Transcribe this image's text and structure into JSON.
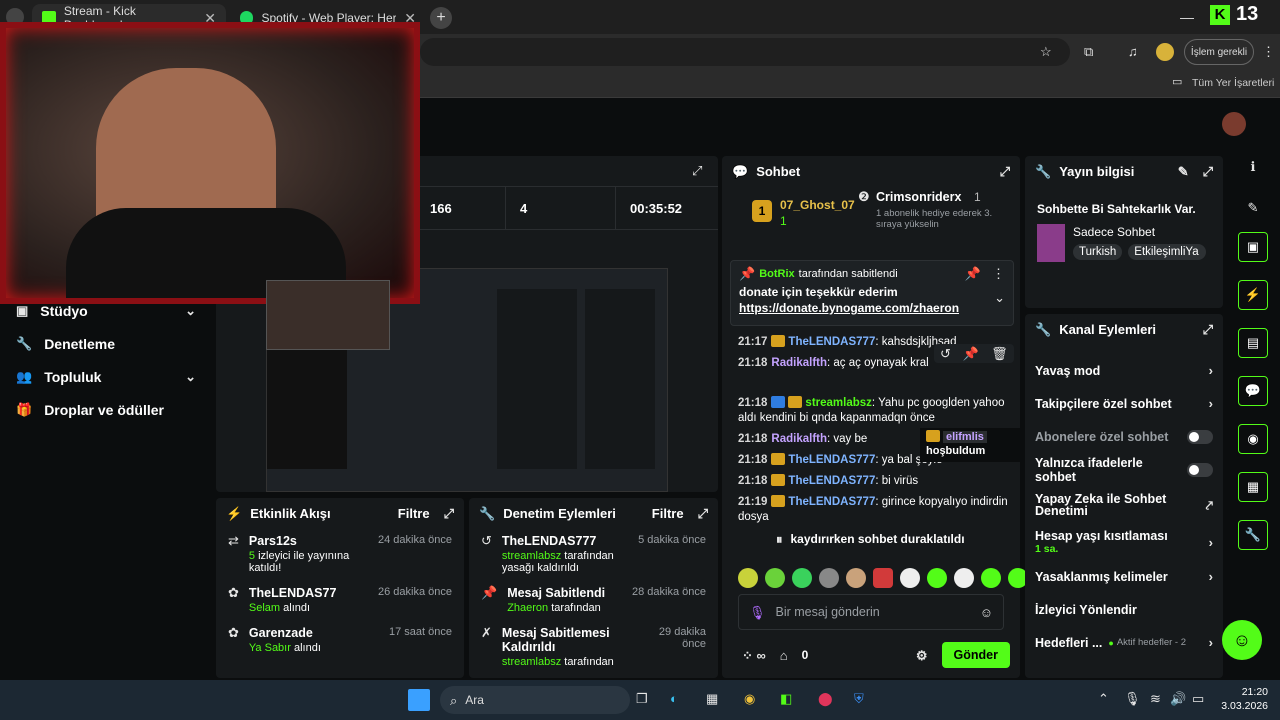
{
  "browser": {
    "tabs": [
      {
        "title": "Stream - Kick Dashboard"
      },
      {
        "title": "Spotify - Web Player: Herşe s"
      }
    ],
    "profile_label": "İşlem gerekli",
    "bookmarks_label": "Tüm Yer İşaretleri",
    "kick_count": "13"
  },
  "sidebar": {
    "items": [
      {
        "label": "Stüdyo"
      },
      {
        "label": "Denetleme"
      },
      {
        "label": "Topluluk"
      },
      {
        "label": "Droplar ve ödüller"
      }
    ]
  },
  "stats": {
    "viewers": "166",
    "followers": "4",
    "duration": "00:35:52"
  },
  "activity": {
    "title": "Etkinlik Akışı",
    "filter": "Filtre",
    "items": [
      {
        "name": "Pars12s",
        "time": "24 dakika önce",
        "hl": "5",
        "rest": " izleyici ile yayınına katıldı!"
      },
      {
        "name": "TheLENDAS77",
        "time": "26 dakika önce",
        "hl": "Selam",
        "rest": " alındı"
      },
      {
        "name": "Garenzade",
        "time": "17 saat önce",
        "hl": "Ya Sabır",
        "rest": " alındı"
      }
    ]
  },
  "moderation": {
    "title": "Denetim Eylemleri",
    "filter": "Filtre",
    "items": [
      {
        "name": "TheLENDAS777",
        "time": "5 dakika önce",
        "hl": "streamlabsz",
        "rest": " tarafından yasağı kaldırıldı"
      },
      {
        "name": "Mesaj Sabitlendi",
        "time": "28 dakika önce",
        "hl": "Zhaeron",
        "rest": " tarafından"
      },
      {
        "name": "Mesaj Sabitlemesi Kaldırıldı",
        "time": "29 dakika önce",
        "hl": "streamlabsz",
        "rest": " tarafından"
      }
    ]
  },
  "chat": {
    "title": "Sohbet",
    "top": {
      "first_name": "07_Ghost_07",
      "first_count": "1",
      "second_name": "Crimsonriderx",
      "second_count": "1",
      "gift_text": "1 abonelik hediye ederek 3. sıraya yükselin"
    },
    "pinned": {
      "by": "BotRix",
      "by_suffix": " tarafından sabitlendi",
      "line1": "donate için teşekkür ederim",
      "link": "https://donate.bynogame.com/zhaeron"
    },
    "messages": [
      {
        "time": "21:17",
        "user": "TheLENDAS777",
        "color": "#7fb4ff",
        "text": ": kahsdsjkljhsad"
      },
      {
        "time": "21:18",
        "user": "Radikalfth",
        "color": "#c4a3ff",
        "text": ": aç aç oynayak kral"
      },
      {
        "time": "21:18",
        "user": "streamlabsz",
        "color": "#53fc18",
        "text": ": Yahu pc googlden yahoo aldı kendini bi qnda kapanmadqn önce"
      },
      {
        "time": "21:18",
        "user": "Radikalfth",
        "color": "#c4a3ff",
        "text": ": vay be"
      },
      {
        "time": "21:18",
        "user": "TheLENDAS777",
        "color": "#7fb4ff",
        "text": ": ya bal şöyle"
      },
      {
        "time": "21:18",
        "user": "TheLENDAS777",
        "color": "#7fb4ff",
        "text": ": bi virüs"
      },
      {
        "time": "21:19",
        "user": "TheLENDAS777",
        "color": "#7fb4ff",
        "text": ": girince kopyalıyo indirdin dosya"
      }
    ],
    "tooltip_user": "elifmlis",
    "tooltip_text": "hoşbuldum",
    "paused": "kaydırırken sohbet duraklatıldı",
    "placeholder": "Bir mesaj gönderin",
    "send": "Gönder",
    "points": "0"
  },
  "stream_info": {
    "title": "Yayın bilgisi",
    "stream_title": "Sohbette Bi Sahtekarlık Var.",
    "category": "Sadece Sohbet",
    "tags": [
      "Turkish",
      "EtkileşimliYa"
    ]
  },
  "channel_actions": {
    "title": "Kanal Eylemleri",
    "items": [
      {
        "label": "Yavaş mod"
      },
      {
        "label": "Takipçilere özel sohbet"
      },
      {
        "label": "Abonelere özel sohbet"
      },
      {
        "label": "Yalnızca ifadelerle sohbet"
      },
      {
        "label": "Yapay Zeka ile Sohbet Denetimi"
      },
      {
        "label": "Hesap yaşı kısıtlaması",
        "sub": "1 sa."
      },
      {
        "label": "Yasaklanmış kelimeler"
      },
      {
        "label": "İzleyici Yönlendir"
      },
      {
        "label": "Hedefleri ...",
        "sub": "Aktif hedefler - 2"
      }
    ]
  },
  "taskbar": {
    "search": "Ara",
    "time": "21:20",
    "date": "3.03.2026"
  }
}
